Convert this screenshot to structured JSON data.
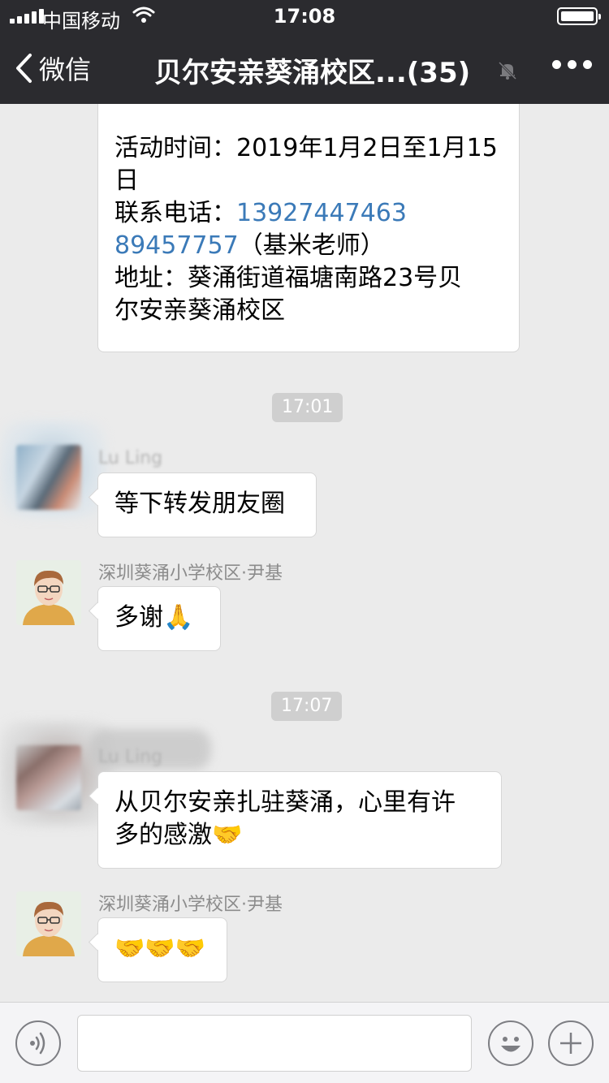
{
  "status_bar": {
    "carrier": "中国移动",
    "time": "17:08"
  },
  "nav": {
    "back_label": "微信",
    "title": "贝尔安亲葵涌校区...(35)"
  },
  "messages": {
    "notice": {
      "line1": "活动时间：2019年1月2日至1月15",
      "line2": "日",
      "phone_label": "联系电话：",
      "phone1": "13927447463",
      "phone2": "89457757",
      "phone2_note": "（基米老师）",
      "addr1": "地址：葵涌街道福塘南路23号贝",
      "addr2": "尔安亲葵涌校区"
    },
    "ts1": "17:01",
    "msg1": {
      "sender": "Lu Ling",
      "text": "等下转发朋友圈"
    },
    "msg2": {
      "sender": "深圳葵涌小学校区·尹基",
      "text": "多谢",
      "emoji": "🙏"
    },
    "ts2": "17:07",
    "msg3": {
      "sender": "Lu Ling",
      "line1": "从贝尔安亲扎驻葵涌，心里有许",
      "line2": "多的感激",
      "emoji": "🤝"
    },
    "msg4": {
      "sender": "深圳葵涌小学校区·尹基",
      "emojis": [
        "🤝",
        "🤝",
        "🤝"
      ]
    }
  },
  "colors": {
    "bar_bg": "#2b2b2f",
    "chat_bg": "#ebebeb",
    "link": "#3b7ab8"
  }
}
